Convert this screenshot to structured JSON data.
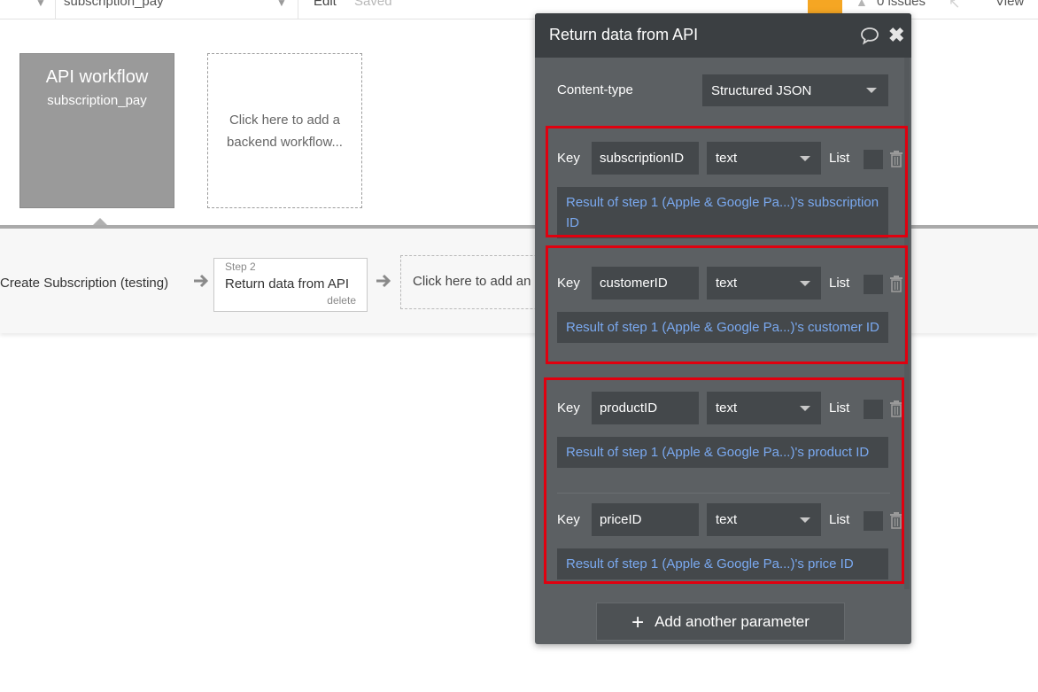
{
  "topbar": {
    "page_select": "subscription_pay",
    "edit_label": "Edit",
    "saved_label": "Saved",
    "issues_label": "0 issues",
    "view_label": "View"
  },
  "canvas": {
    "api_card": {
      "title": "API workflow",
      "name": "subscription_pay"
    },
    "add_backend": "Click here to add a backend workflow..."
  },
  "steps": {
    "step1_name": "Create Subscription (testing)",
    "step2_label": "Step 2",
    "step2_name": "Return data from API",
    "step2_delete": "delete",
    "add_action": "Click here to add an"
  },
  "panel": {
    "title": "Return data from API",
    "content_type_label": "Content-type",
    "content_type_value": "Structured JSON",
    "key_label": "Key",
    "list_label": "List",
    "params": [
      {
        "key": "subscriptionID",
        "type": "text",
        "value": "Result of step 1 (Apple & Google Pa...)'s subscription ID"
      },
      {
        "key": "customerID",
        "type": "text",
        "value": "Result of step 1 (Apple & Google Pa...)'s customer ID"
      },
      {
        "key": "productID",
        "type": "text",
        "value": "Result of step 1 (Apple & Google Pa...)'s product ID"
      },
      {
        "key": "priceID",
        "type": "text",
        "value": "Result of step 1 (Apple & Google Pa...)'s price ID"
      }
    ],
    "add_param": "Add another parameter"
  },
  "colors": {
    "panel_bg": "#5c6063",
    "panel_header": "#3b3f42",
    "input_bg": "#44484b",
    "link_text": "#7aa9f0",
    "highlight": "#e0000f",
    "upgrade": "#f5a623"
  },
  "icons": [
    "chevron-down-icon",
    "warning-icon",
    "cursor-icon",
    "comment-icon",
    "close-icon",
    "trash-icon",
    "plus-icon",
    "arrow-right-icon"
  ]
}
